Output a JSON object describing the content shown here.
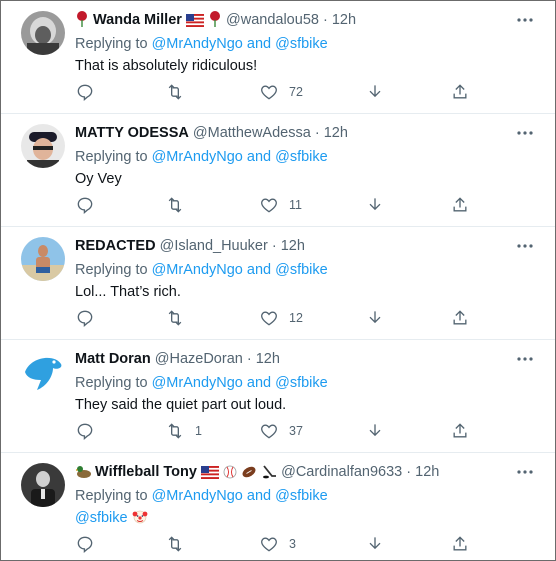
{
  "colors": {
    "link": "#1d9bf0",
    "muted": "#536471",
    "text": "#0f1419"
  },
  "icons": [
    "reply-icon",
    "retweet-icon",
    "like-icon",
    "download-icon",
    "share-icon",
    "more-icon"
  ],
  "tweets": [
    {
      "name": "Wanda Miller",
      "name_icons": [
        "rose-emoji",
        "us-flag-emoji",
        "rose-emoji"
      ],
      "handle": "@wandalou58",
      "time": "12h",
      "replying_to_label": "Replying to",
      "mention1": "@MrAndyNgo",
      "and_label": "and",
      "mention2": "@sfbike",
      "body": "That is absolutely ridiculous!",
      "retweets": "",
      "likes": "72"
    },
    {
      "name": "MATTY ODESSA",
      "handle": "@MatthewAdessa",
      "time": "12h",
      "replying_to_label": "Replying to",
      "mention1": "@MrAndyNgo",
      "and_label": "and",
      "mention2": "@sfbike",
      "body": "Oy Vey",
      "retweets": "",
      "likes": "11"
    },
    {
      "name": "REDACTED",
      "handle": "@Island_Huuker",
      "time": "12h",
      "replying_to_label": "Replying to",
      "mention1": "@MrAndyNgo",
      "and_label": "and",
      "mention2": "@sfbike",
      "body": "Lol... That’s rich.",
      "retweets": "",
      "likes": "12"
    },
    {
      "name": "Matt Doran",
      "handle": "@HazeDoran",
      "time": "12h",
      "replying_to_label": "Replying to",
      "mention1": "@MrAndyNgo",
      "and_label": "and",
      "mention2": "@sfbike",
      "body": "They said the quiet part out loud.",
      "retweets": "1",
      "likes": "37"
    },
    {
      "name": "Wiffleball Tony",
      "name_icons": [
        "duck-emoji",
        "us-flag-emoji",
        "baseball-emoji",
        "football-emoji",
        "hockey-emoji"
      ],
      "handle": "@Cardinalfan9633",
      "time": "12h",
      "replying_to_label": "Replying to",
      "mention1": "@MrAndyNgo",
      "and_label": "and",
      "mention2": "@sfbike",
      "body_mention": "@sfbike",
      "body_icon": "clown-face-emoji",
      "retweets": "",
      "likes": "3"
    }
  ]
}
